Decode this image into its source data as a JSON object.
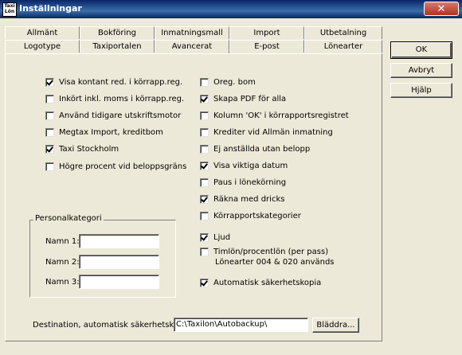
{
  "window": {
    "title": "Inställningar",
    "app_icon_text": "Taxi Lön",
    "close_glyph": "✕"
  },
  "tabs": {
    "row1": [
      "Allmänt",
      "Bokföring",
      "Inmatningsmall",
      "Import",
      "Utbetalning"
    ],
    "row2": [
      "Logotype",
      "Taxiportalen",
      "Avancerat",
      "E-post",
      "Lönearter"
    ],
    "active": "Avancerat"
  },
  "left_checks": [
    {
      "label": "Visa kontant red. i körrapp.reg.",
      "checked": true
    },
    {
      "label": "Inkört inkl. moms i körrapp.reg.",
      "checked": false
    },
    {
      "label": "Använd tidigare utskriftsmotor",
      "checked": false
    },
    {
      "label": "Megtax Import, kreditbom",
      "checked": false
    },
    {
      "label": "Taxi Stockholm",
      "checked": true
    },
    {
      "label": "Högre procent vid beloppsgräns",
      "checked": false
    }
  ],
  "right_checks": [
    {
      "label": "Oreg. bom",
      "checked": false
    },
    {
      "label": "Skapa PDF för alla",
      "checked": true
    },
    {
      "label": "Kolumn 'OK' i körrapportsregistret",
      "checked": false
    },
    {
      "label": "Krediter vid Allmän inmatning",
      "checked": false
    },
    {
      "label": "Ej anställda utan belopp",
      "checked": false
    },
    {
      "label": "Visa viktiga datum",
      "checked": true
    },
    {
      "label": "Paus i lönekörning",
      "checked": false
    },
    {
      "label": "Räkna med dricks",
      "checked": true
    },
    {
      "label": "Körrapportskategorier",
      "checked": false
    },
    {
      "label": "Ljud",
      "checked": true
    },
    {
      "label": "Timlön/procentlön (per pass)",
      "checked": false
    },
    {
      "label": "Automatisk säkerhetskopia",
      "checked": true
    }
  ],
  "timlon_sublabel": "Lönearter 004 & 020 används",
  "personalkategori": {
    "title": "Personalkategori",
    "fields": [
      {
        "label": "Namn 1:",
        "value": ""
      },
      {
        "label": "Namn 2:",
        "value": ""
      },
      {
        "label": "Namn 3:",
        "value": ""
      }
    ]
  },
  "backup": {
    "label": "Destination, automatisk säkerhetskopia:",
    "path": "C:\\Taxilon\\Autobackup\\",
    "browse_label": "Bläddra..."
  },
  "buttons": {
    "ok": "OK",
    "cancel": "Avbryt",
    "help": "Hjälp"
  }
}
